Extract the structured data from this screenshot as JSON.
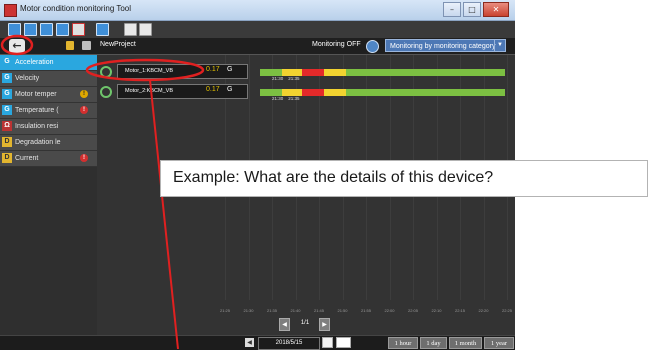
{
  "window": {
    "title": "Motor condition monitoring Tool",
    "buttons": {
      "minimize": "–",
      "maximize": "□",
      "close": "✕"
    }
  },
  "toolbar": {
    "icons": [
      "new-project-icon",
      "open-folder-icon",
      "save-icon",
      "save-as-icon",
      "delete-icon",
      "export-icon",
      "help-icon",
      "info-icon"
    ]
  },
  "subbar": {
    "back_label": "←",
    "project_name": "NewProject",
    "monitoring_status": "Monitoring OFF",
    "monitoring_mode": "Monitoring by monitoring category",
    "dropdown_arrow": "▼"
  },
  "sidebar": {
    "items": [
      {
        "icon_text": "G",
        "label": "Acceleration",
        "badge": "",
        "active": true
      },
      {
        "icon_text": "G",
        "label": "Velocity",
        "badge": "",
        "active": false
      },
      {
        "icon_text": "G",
        "label": "Motor temper",
        "badge": "!",
        "badge_color": "yellow",
        "active": false
      },
      {
        "icon_text": "G",
        "label": "Temperature (",
        "badge": "!",
        "badge_color": "red",
        "active": false
      },
      {
        "icon_text": "Ω",
        "label": "Insulation resi",
        "badge": "",
        "active": false
      },
      {
        "icon_text": "D",
        "label": "Degradation le",
        "badge": "",
        "active": false
      },
      {
        "icon_text": "D",
        "label": "Current",
        "badge": "!",
        "badge_color": "red",
        "active": false
      }
    ]
  },
  "devices": [
    {
      "name": "Motor_1:KBCM_VB",
      "value": "0.17",
      "unit": "G",
      "times": [
        "21:30",
        "21:35"
      ],
      "segments": [
        {
          "color": "#7cc042",
          "share": 0.09
        },
        {
          "color": "#f2d330",
          "share": 0.08
        },
        {
          "color": "#e42a2a",
          "share": 0.09
        },
        {
          "color": "#f2d330",
          "share": 0.09
        },
        {
          "color": "#7cc042",
          "share": 0.65
        }
      ]
    },
    {
      "name": "Motor_2:KBCM_VB",
      "value": "0.17",
      "unit": "G",
      "times": [
        "21:30",
        "21:35"
      ],
      "segments": [
        {
          "color": "#7cc042",
          "share": 0.09
        },
        {
          "color": "#f2d330",
          "share": 0.08
        },
        {
          "color": "#e42a2a",
          "share": 0.09
        },
        {
          "color": "#f2d330",
          "share": 0.09
        },
        {
          "color": "#7cc042",
          "share": 0.65
        }
      ]
    }
  ],
  "timeline_ticks": [
    "21:25",
    "21:30",
    "21:35",
    "21:40",
    "21:45",
    "21:50",
    "21:55",
    "22:00",
    "22:05",
    "22:10",
    "22:15",
    "22:20",
    "22:25"
  ],
  "pager": {
    "prev": "◀",
    "page": "1/1",
    "next": "▶"
  },
  "footer": {
    "prev_day": "◀",
    "date": "2018/5/15",
    "range_buttons": [
      "1 hour",
      "1 day",
      "1 month",
      "1 year"
    ]
  },
  "annotation": {
    "callout_text": "Example: What are the details of this device?",
    "color": "#e02020"
  },
  "colors": {
    "accent": "#2aa7df",
    "ok": "#7cc042",
    "warn": "#f2d330",
    "alarm": "#e42a2a"
  }
}
